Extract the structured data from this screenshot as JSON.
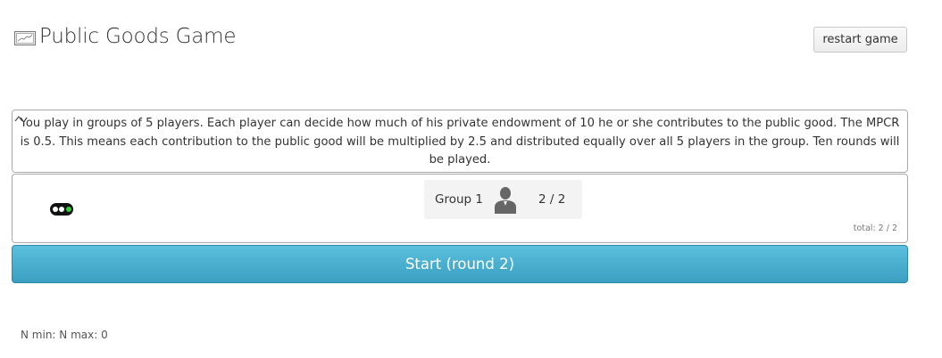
{
  "header": {
    "title": "Public Goods Game",
    "logo_icon": "chart-image-icon",
    "restart_label": "restart game"
  },
  "instructions": {
    "text": "You play in groups of 5 players. Each player can decide how much of his private endowment of 10 he or she contributes to the public good. The MPCR is 0.5. This means each contribution to the public good will be multiplied by 2.5 and distributed equally over all 5 players in the group. Ten rounds will be played.",
    "collapse_icon": "caret-up-icon"
  },
  "status": {
    "icon": "traffic-light-icon",
    "lights": [
      "#ffffff",
      "#ffffff",
      "#33cc33"
    ]
  },
  "group": {
    "label": "Group 1",
    "icon": "person-icon",
    "count": "2 / 2"
  },
  "total": "total: 2 / 2",
  "start_label": "Start (round 2)",
  "footer": "N min: N max: 0",
  "colors": {
    "start_button": "#4ab0d1",
    "border": "#aaaaaa"
  }
}
